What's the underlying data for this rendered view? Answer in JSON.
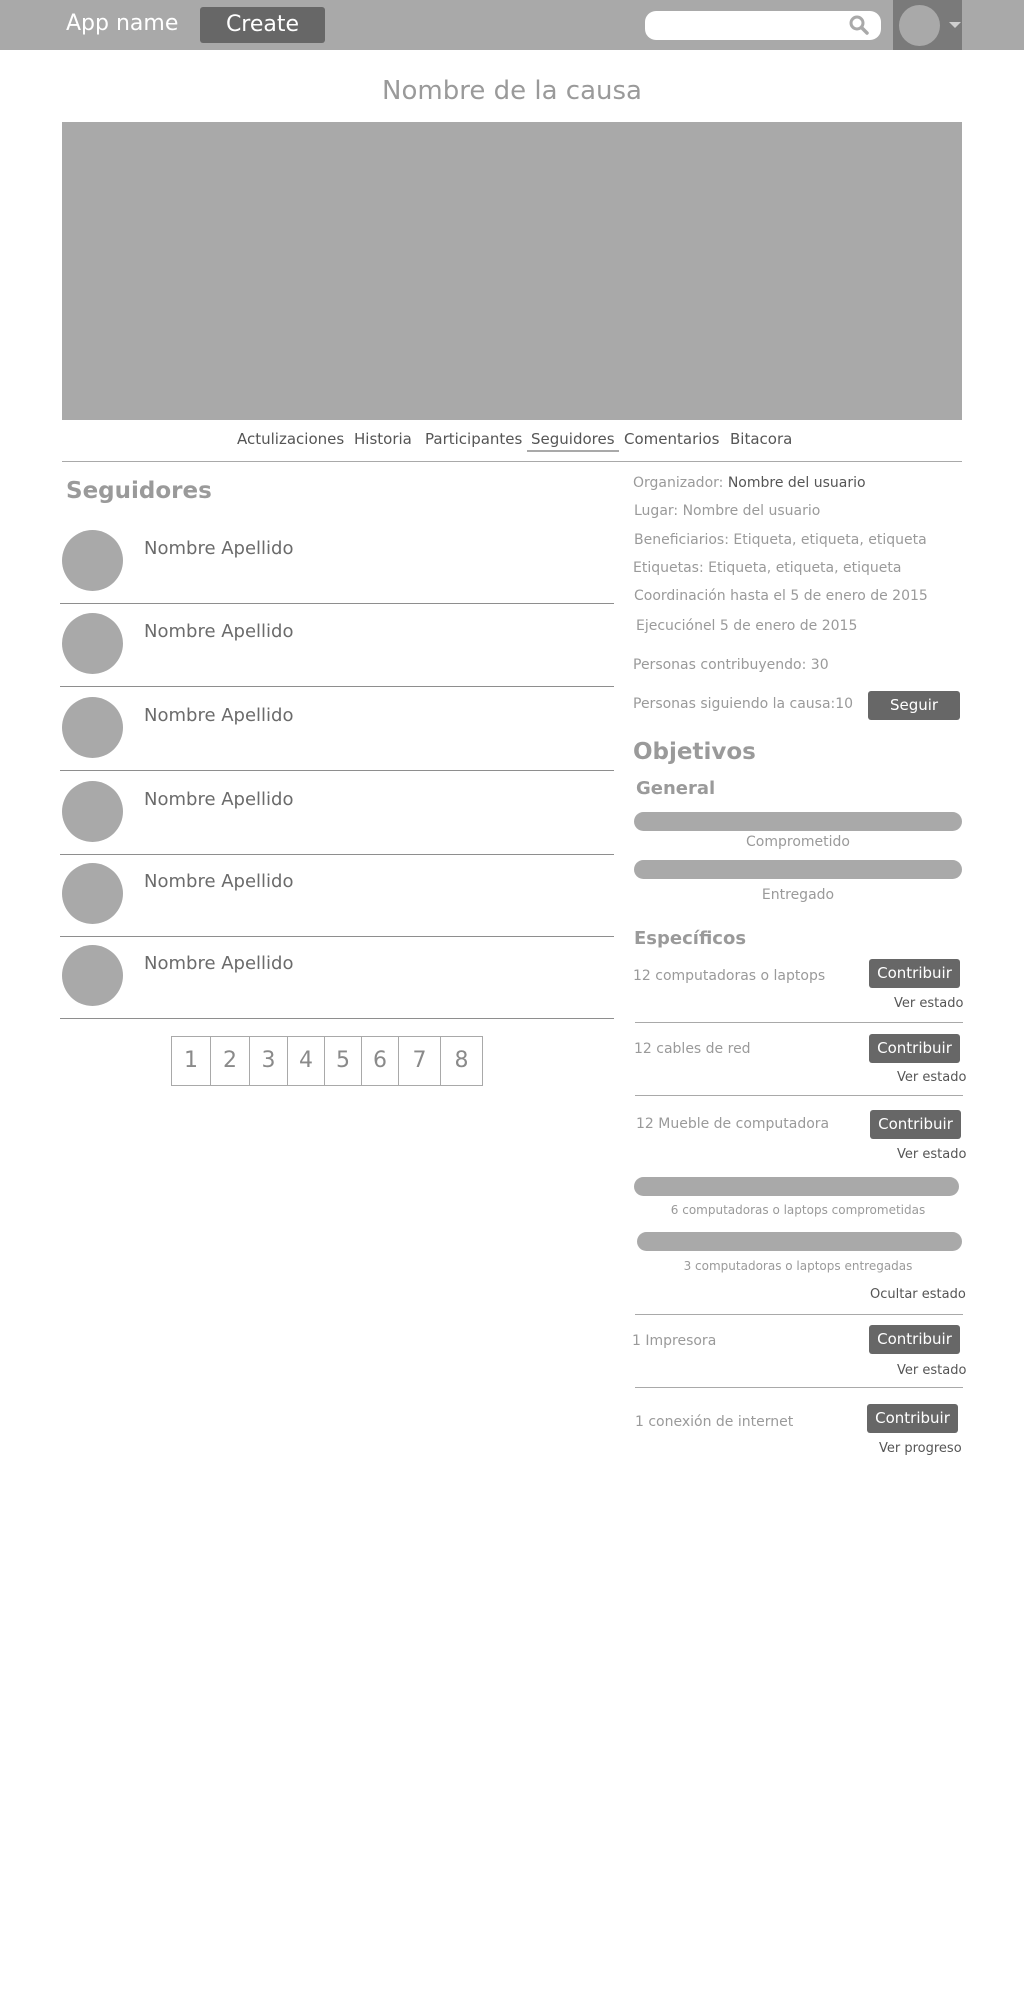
{
  "header": {
    "app_name": "App name",
    "create_label": "Create",
    "search_placeholder": ""
  },
  "cause": {
    "title": "Nombre de la causa"
  },
  "tabs": [
    {
      "label": "Actulizaciones",
      "active": false
    },
    {
      "label": "Historia",
      "active": false
    },
    {
      "label": "Participantes",
      "active": false
    },
    {
      "label": "Seguidores",
      "active": true
    },
    {
      "label": "Comentarios",
      "active": false
    },
    {
      "label": "Bitacora",
      "active": false
    }
  ],
  "followers": {
    "title": "Seguidores",
    "items": [
      {
        "name": "Nombre Apellido"
      },
      {
        "name": "Nombre Apellido"
      },
      {
        "name": "Nombre Apellido"
      },
      {
        "name": "Nombre Apellido"
      },
      {
        "name": "Nombre Apellido"
      },
      {
        "name": "Nombre Apellido"
      }
    ]
  },
  "pagination": [
    "1",
    "2",
    "3",
    "4",
    "5",
    "6",
    "7",
    "8"
  ],
  "info": {
    "organizer_label": "Organizador:",
    "organizer_value": "Nombre del usuario",
    "place": "Lugar: Nombre del usuario",
    "beneficiaries": "Beneficiarios: Etiqueta, etiqueta, etiqueta",
    "tags": "Etiquetas: Etiqueta, etiqueta, etiqueta",
    "coordination": "Coordinación hasta el 5 de enero de 2015",
    "execution": "Ejecuciónel 5 de enero de 2015",
    "contributors": "Personas contribuyendo: 30",
    "followers_count": "Personas siguiendo la causa:10",
    "follow_label": "Seguir"
  },
  "objectives": {
    "title": "Objetivos",
    "general_title": "General",
    "committed_label": "Comprometido",
    "delivered_label": "Entregado",
    "specific_title": "Específicos",
    "items": [
      {
        "label": "12 computadoras o laptops",
        "button": "Contribuir",
        "link": "Ver estado"
      },
      {
        "label": "12 cables de red",
        "button": "Contribuir",
        "link": "Ver estado"
      },
      {
        "label": "12 Mueble de computadora",
        "button": "Contribuir",
        "link": "Ver estado"
      },
      {
        "label": "1 Impresora",
        "button": "Contribuir",
        "link": "Ver estado"
      },
      {
        "label": "1 conexión de internet",
        "button": "Contribuir",
        "link": "Ver progreso"
      }
    ],
    "detail": {
      "committed_text": "6 computadoras o laptops comprometidas",
      "delivered_text": "3 computadoras o laptops entregadas",
      "hide_label": "Ocultar estado"
    }
  },
  "colors": {
    "header_bg": "#a9a9a9",
    "button_bg": "#676767",
    "placeholder_gray": "#a9a9a9"
  }
}
